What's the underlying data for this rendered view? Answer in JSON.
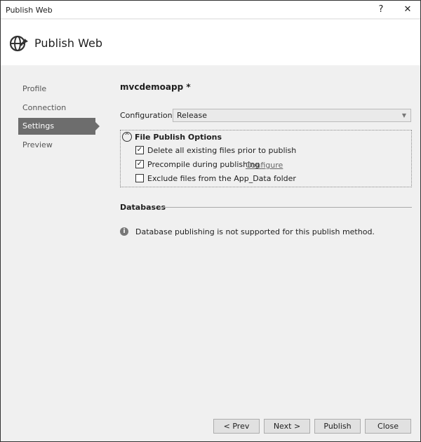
{
  "window": {
    "title": "Publish Web",
    "help": "?",
    "close": "✕"
  },
  "header": {
    "title": "Publish Web",
    "icon": "globe-publish-icon"
  },
  "sidebar": {
    "items": [
      {
        "label": "Profile"
      },
      {
        "label": "Connection"
      },
      {
        "label": "Settings",
        "selected": true
      },
      {
        "label": "Preview"
      }
    ]
  },
  "main": {
    "profile_name": "mvcdemoapp *",
    "configuration": {
      "label": "Configuration:",
      "value": "Release"
    },
    "file_publish": {
      "title": "File Publish Options",
      "options": [
        {
          "label": "Delete all existing files prior to publish",
          "checked": true
        },
        {
          "label": "Precompile during publishing",
          "checked": true,
          "link": "Configure"
        },
        {
          "label": "Exclude files from the App_Data folder",
          "checked": false
        }
      ]
    },
    "databases": {
      "title": "Databases",
      "info": "Database publishing is not supported for this publish method."
    }
  },
  "footer": {
    "prev": "< Prev",
    "next": "Next >",
    "publish": "Publish",
    "close": "Close"
  }
}
